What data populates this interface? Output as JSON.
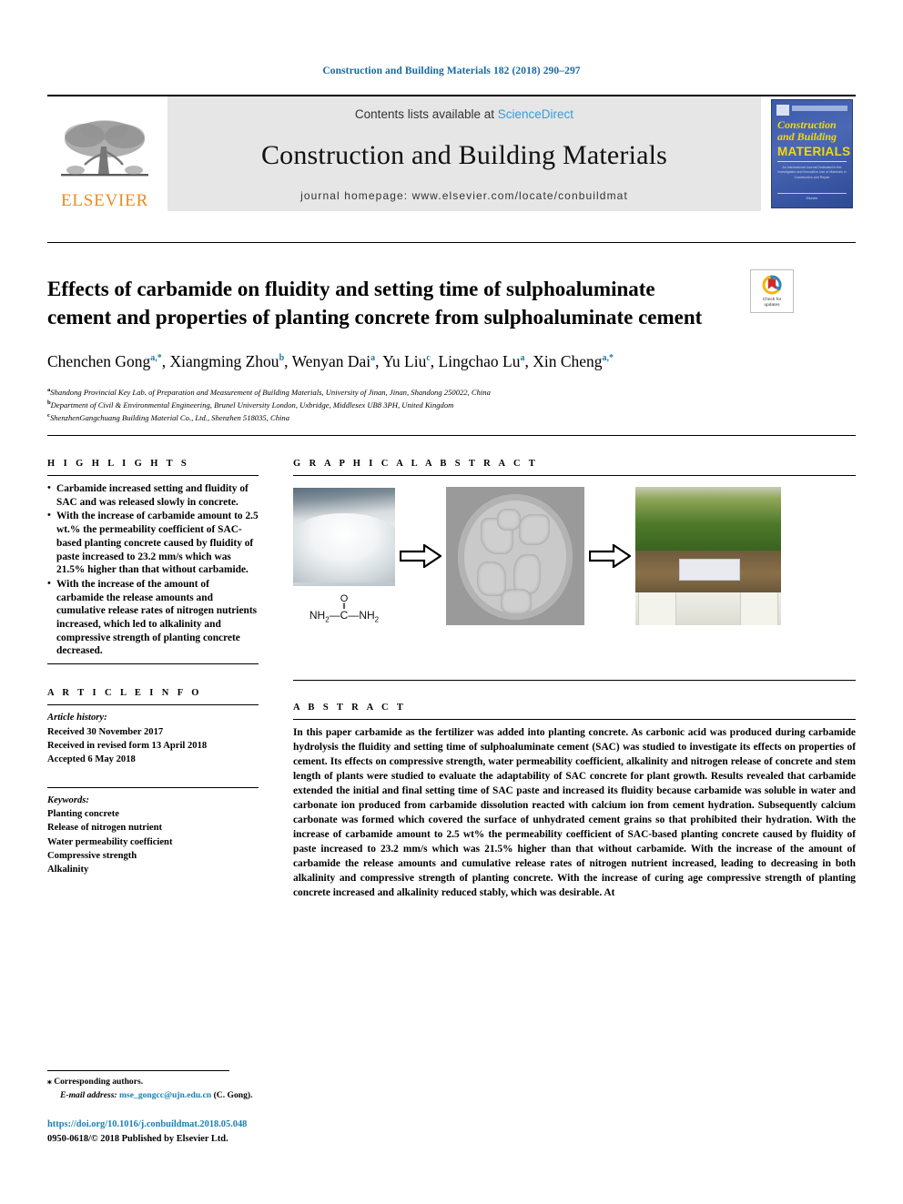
{
  "running_head": "Construction and Building Materials 182 (2018) 290–297",
  "masthead": {
    "publisher_name": "ELSEVIER",
    "contents_prefix": "Contents lists available at",
    "sciencedirect_label": "ScienceDirect",
    "journal_name": "Construction and Building Materials",
    "homepage_label": "journal homepage: www.elsevier.com/locate/conbuildmat",
    "cover": {
      "line1": "Construction",
      "line2": "and Building",
      "line3": "MATERIALS",
      "subtitle": "An International Journal Dedicated to the Investigation and Innovative Use of Materials in Construction and Repair",
      "footer": "Elsevier"
    },
    "accent_color": "#3a9bd5",
    "brand_color": "#f08a1c"
  },
  "article": {
    "title": "Effects of carbamide on fluidity and setting time of sulphoaluminate cement and properties of planting concrete from sulphoaluminate cement",
    "crossmark_line1": "Check for",
    "crossmark_line2": "updates",
    "authors": [
      {
        "name": "Chenchen Gong",
        "sup": "a,*"
      },
      {
        "name": "Xiangming Zhou",
        "sup": "b"
      },
      {
        "name": "Wenyan Dai",
        "sup": "a"
      },
      {
        "name": "Yu Liu",
        "sup": "c"
      },
      {
        "name": "Lingchao Lu",
        "sup": "a"
      },
      {
        "name": "Xin Cheng",
        "sup": "a,*"
      }
    ],
    "affiliations": [
      {
        "label": "a",
        "text": "Shandong Provincial Key Lab. of Preparation and Measurement of Building Materials, University of Jinan, Jinan, Shandong 250022, China"
      },
      {
        "label": "b",
        "text": "Department of Civil & Environmental Engineering, Brunel University London, Uxbridge, Middlesex UB8 3PH, United Kingdom"
      },
      {
        "label": "c",
        "text": "ShenzhenGangchuang Building Material Co., Ltd., Shenzhen 518035, China"
      }
    ]
  },
  "highlights": {
    "heading": "H I G H L I G H T S",
    "items": [
      "Carbamide increased setting and fluidity of SAC and was released slowly in concrete.",
      "With the increase of carbamide amount to 2.5 wt.% the permeability coefficient of SAC-based planting concrete caused by fluidity of paste increased to 23.2 mm/s which was 21.5% higher than that without carbamide.",
      "With the increase of the amount of carbamide the release amounts and cumulative release rates of nitrogen nutrients increased, which led to alkalinity and compressive strength of planting concrete decreased."
    ]
  },
  "graphical_abstract": {
    "heading": "G R A P H I C A L   A B S T R A C T",
    "images": [
      {
        "name": "carbamide-granules-photo",
        "caption": ""
      },
      {
        "name": "planting-concrete-specimen-photo",
        "caption": ""
      },
      {
        "name": "grass-growth-photo",
        "caption": ""
      }
    ],
    "formula": {
      "left": "NH",
      "left_sub": "2",
      "center": "C",
      "right": "NH",
      "right_sub": "2",
      "top": "O"
    },
    "arrows": 2
  },
  "article_info": {
    "heading": "A R T I C L E   I N F O",
    "history_label": "Article history:",
    "history": [
      "Received 30 November 2017",
      "Received in revised form 13 April 2018",
      "Accepted 6 May 2018"
    ],
    "keywords_label": "Keywords:",
    "keywords": [
      "Planting concrete",
      "Release of nitrogen nutrient",
      "Water permeability coefficient",
      "Compressive strength",
      "Alkalinity"
    ]
  },
  "abstract": {
    "heading": "A B S T R A C T",
    "text": "In this paper carbamide as the fertilizer was added into planting concrete. As carbonic acid was produced during carbamide hydrolysis the fluidity and setting time of sulphoaluminate cement (SAC) was studied to investigate its effects on properties of cement. Its effects on compressive strength, water permeability coefficient, alkalinity and nitrogen release of concrete and stem length of plants were studied to evaluate the adaptability of SAC concrete for plant growth. Results revealed that carbamide extended the initial and final setting time of SAC paste and increased its fluidity because carbamide was soluble in water and carbonate ion produced from carbamide dissolution reacted with calcium ion from cement hydration. Subsequently calcium carbonate was formed which covered the surface of unhydrated cement grains so that prohibited their hydration. With the increase of carbamide amount to 2.5 wt% the permeability coefficient of SAC-based planting concrete caused by fluidity of paste increased to 23.2 mm/s which was 21.5% higher than that without carbamide. With the increase of the amount of carbamide the release amounts and cumulative release rates of nitrogen nutrient increased, leading to decreasing in both alkalinity and compressive strength of planting concrete. With the increase of curing age compressive strength of planting concrete increased and alkalinity reduced stably, which was desirable. At"
  },
  "footer": {
    "corresponding_marker": "⁎",
    "corresponding_label": "Corresponding authors.",
    "email_label": "E-mail address:",
    "email": "mse_gongcc@ujn.edu.cn",
    "email_owner": "(C. Gong).",
    "doi": "https://doi.org/10.1016/j.conbuildmat.2018.05.048",
    "copyright": "0950-0618/© 2018 Published by Elsevier Ltd.",
    "link_color": "#1b7fb5"
  }
}
